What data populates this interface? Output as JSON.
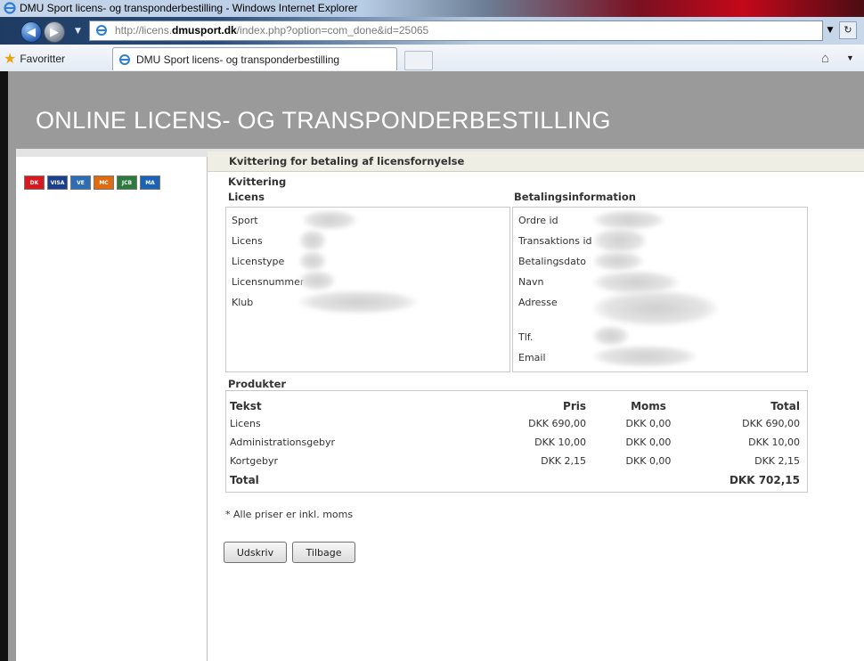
{
  "window": {
    "title": "DMU Sport licens- og transponderbestilling - Windows Internet Explorer",
    "url_prefix": "http://licens.",
    "url_domain": "dmusport.dk",
    "url_path": "/index.php?option=com_done&id=25065"
  },
  "favorites": {
    "label": "Favoritter",
    "tab_title": "DMU Sport licens- og transponderbestilling"
  },
  "banner": {
    "title": "ONLINE LICENS- OG TRANSPONDERBESTILLING"
  },
  "sidebar": {
    "cards": [
      {
        "name": "dankort",
        "label": "DK",
        "color": "#d71920"
      },
      {
        "name": "visa",
        "label": "VISA",
        "color": "#1a3f8f"
      },
      {
        "name": "visa-electron",
        "label": "VE",
        "color": "#2e6db4"
      },
      {
        "name": "mastercard",
        "label": "MC",
        "color": "#e06a10"
      },
      {
        "name": "jcb",
        "label": "JCB",
        "color": "#2d7a3e"
      },
      {
        "name": "maestro",
        "label": "MA",
        "color": "#1c63b8"
      }
    ]
  },
  "page": {
    "header": "Kvittering for betaling af licensfornyelse",
    "kvittering_label": "Kvittering",
    "licens_label": "Licens",
    "betaling_label": "Betalingsinformation",
    "licens_fields": [
      "Sport",
      "Licens",
      "Licenstype",
      "Licensnummer",
      "Klub"
    ],
    "betaling_fields": [
      "Ordre id",
      "Transaktions id",
      "Betalingsdato",
      "Navn",
      "Adresse",
      "Tlf.",
      "Email"
    ],
    "produkter_label": "Produkter"
  },
  "products": {
    "headers": {
      "tekst": "Tekst",
      "pris": "Pris",
      "moms": "Moms",
      "total": "Total"
    },
    "rows": [
      {
        "tekst": "Licens",
        "pris": "DKK 690,00",
        "moms": "DKK 0,00",
        "total": "DKK 690,00"
      },
      {
        "tekst": "Administrationsgebyr",
        "pris": "DKK 10,00",
        "moms": "DKK 0,00",
        "total": "DKK 10,00"
      },
      {
        "tekst": "Kortgebyr",
        "pris": "DKK 2,15",
        "moms": "DKK 0,00",
        "total": "DKK 2,15"
      }
    ],
    "total_label": "Total",
    "total_value": "DKK 702,15"
  },
  "footer": {
    "note": "* Alle priser er inkl. moms",
    "print_button": "Udskriv",
    "back_button": "Tilbage"
  }
}
